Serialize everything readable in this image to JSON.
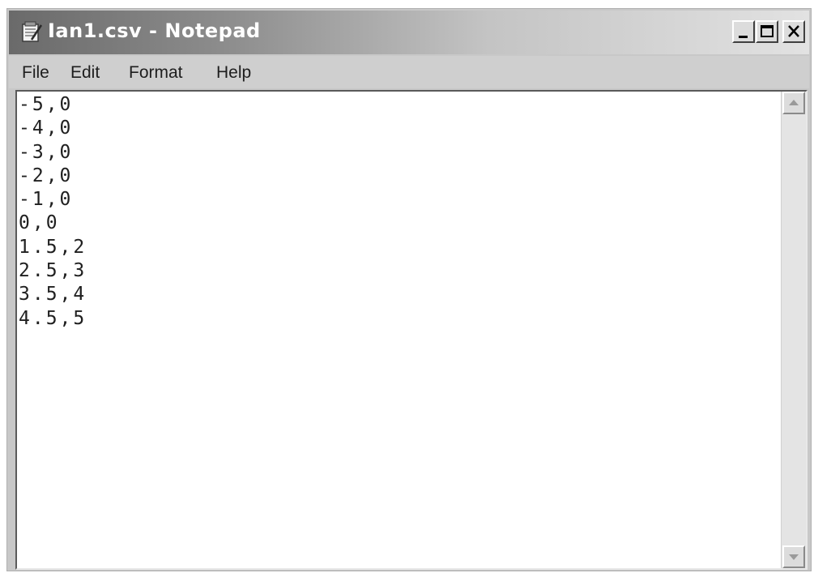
{
  "window": {
    "title": "Ian1.csv - Notepad",
    "controls": {
      "minimize": "minimize-icon",
      "maximize": "maximize-icon",
      "close": "close-icon"
    }
  },
  "menu": {
    "file": "File",
    "edit": "Edit",
    "format": "Format",
    "help": "Help"
  },
  "content": {
    "lines": [
      "-5,0",
      "-4,0",
      "-3,0",
      "-2,0",
      "-1,0",
      "0,0",
      "1.5,2",
      "2.5,3",
      "3.5,4",
      "4.5,5"
    ]
  },
  "colors": {
    "titlebar_start": "#6a6a6a",
    "titlebar_end": "#e2e2e2",
    "title_text": "#ffffff",
    "window_bg": "#c8c8c8",
    "editor_bg": "#ffffff"
  },
  "icons": {
    "app": "notepad-icon",
    "scroll_up": "arrow-up-icon",
    "scroll_down": "arrow-down-icon"
  }
}
